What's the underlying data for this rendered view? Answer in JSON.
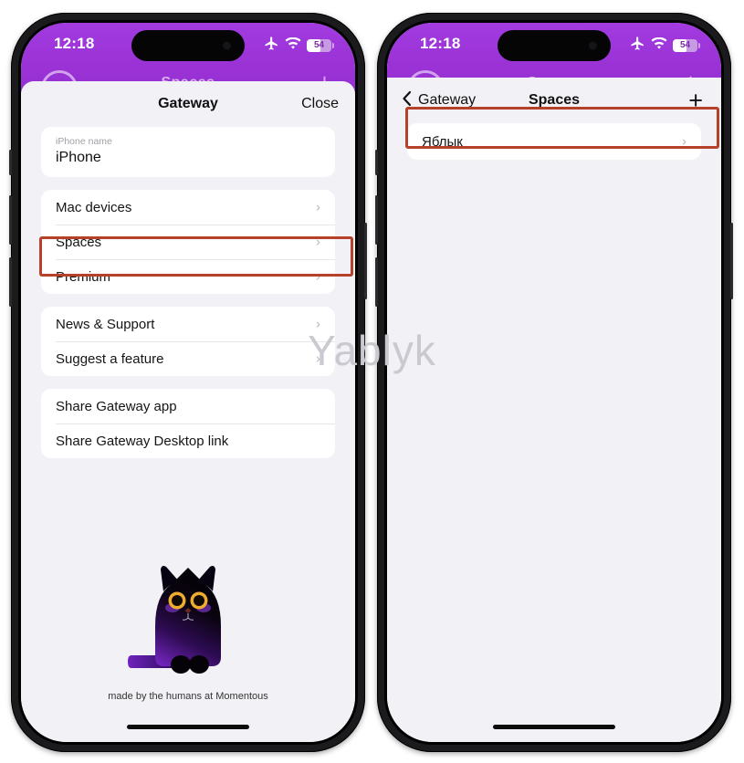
{
  "watermark": "Yablyk",
  "status_bar": {
    "time": "12:18",
    "icons": [
      "airplane-mode-icon",
      "wifi-icon",
      "battery-icon"
    ],
    "battery_percent": "54"
  },
  "colors": {
    "app_purple": "#9a32d6",
    "highlight_red": "#b5412b",
    "sheet_bg": "#f2f1f6",
    "card_bg": "#ffffff",
    "chevron": "#b9b9bf"
  },
  "background_app": {
    "title_ghost": "Spaces",
    "plus_ghost": "+"
  },
  "left_phone": {
    "navbar": {
      "title": "Gateway",
      "close_label": "Close"
    },
    "name_field": {
      "label": "iPhone name",
      "value": "iPhone",
      "placeholder": "iPhone name"
    },
    "groups": [
      {
        "rows": [
          {
            "label": "Mac devices",
            "chevron": true,
            "highlighted": false
          },
          {
            "label": "Spaces",
            "chevron": true,
            "highlighted": true
          },
          {
            "label": "Premium",
            "chevron": true,
            "highlighted": false
          }
        ]
      },
      {
        "rows": [
          {
            "label": "News & Support",
            "chevron": true,
            "highlighted": false
          },
          {
            "label": "Suggest a feature",
            "chevron": true,
            "highlighted": false
          }
        ]
      },
      {
        "rows": [
          {
            "label": "Share Gateway app",
            "chevron": false,
            "highlighted": false
          },
          {
            "label": "Share Gateway Desktop link",
            "chevron": false,
            "highlighted": false
          }
        ]
      }
    ],
    "footer": {
      "illustration": "black-cat-illustration",
      "credit": "made by the humans at Momentous"
    }
  },
  "right_phone": {
    "navbar": {
      "back_label": "Gateway",
      "title": "Spaces",
      "add_label": "+"
    },
    "spaces": [
      {
        "label": "Яблык",
        "chevron": true,
        "highlighted": true
      }
    ]
  }
}
